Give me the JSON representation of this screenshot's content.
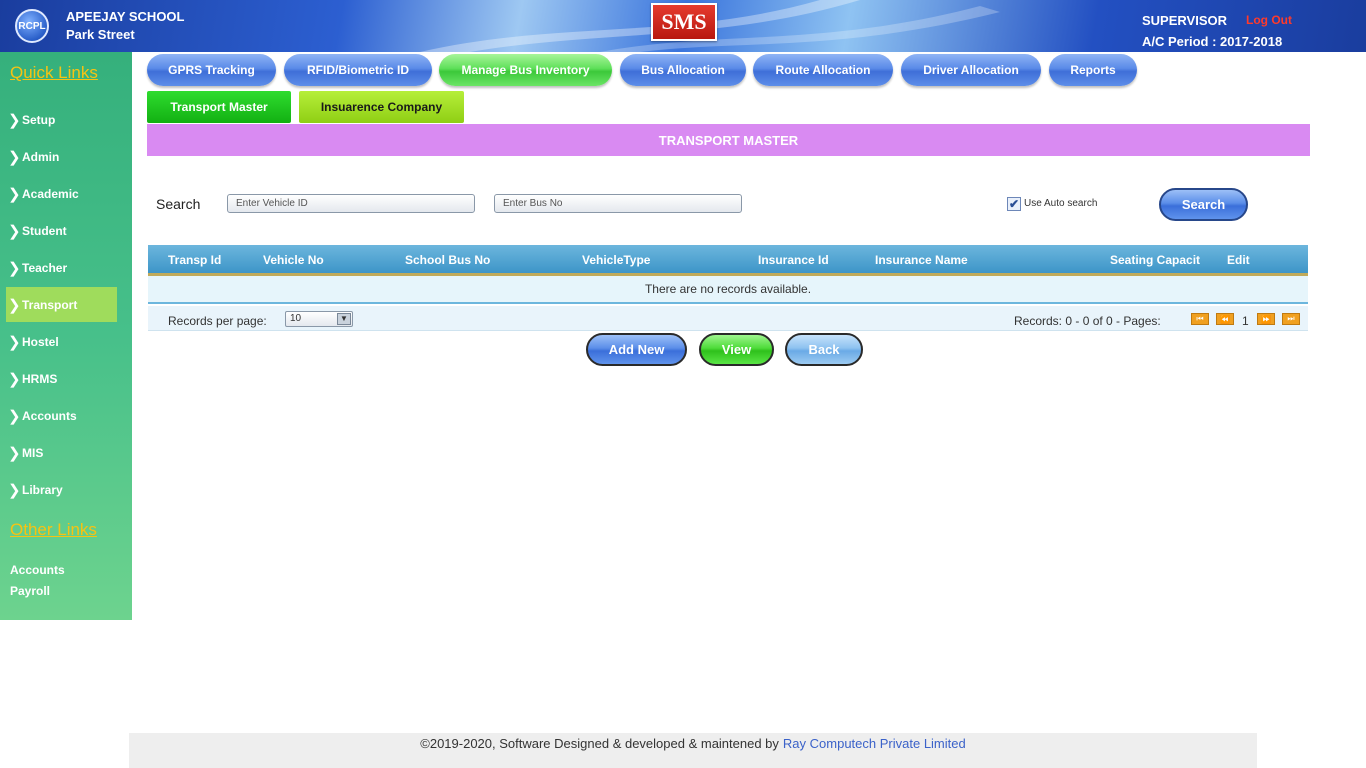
{
  "header": {
    "school_name_line1": "APEEJAY SCHOOL",
    "school_name_line2": "Park Street",
    "logo_text": "RCPL",
    "app_logo": "SMS",
    "user_role": "SUPERVISOR",
    "logout_label": "Log Out",
    "ac_period": "A/C Period : 2017-2018"
  },
  "sidebar": {
    "quick_links_heading": "Quick Links",
    "items": [
      {
        "label": "Setup"
      },
      {
        "label": "Admin"
      },
      {
        "label": "Academic"
      },
      {
        "label": "Student"
      },
      {
        "label": "Teacher"
      },
      {
        "label": "Transport",
        "active": true
      },
      {
        "label": "Hostel"
      },
      {
        "label": "HRMS"
      },
      {
        "label": "Accounts"
      },
      {
        "label": "MIS"
      },
      {
        "label": "Library"
      }
    ],
    "other_links_heading": "Other Links",
    "other_links": [
      {
        "label": "Accounts"
      },
      {
        "label": "Payroll"
      }
    ]
  },
  "top_nav": {
    "tabs": [
      {
        "label": "GPRS Tracking"
      },
      {
        "label": "RFID/Biometric ID"
      },
      {
        "label": "Manage Bus Inventory",
        "active": true
      },
      {
        "label": "Bus Allocation"
      },
      {
        "label": "Route Allocation"
      },
      {
        "label": "Driver Allocation"
      },
      {
        "label": "Reports"
      }
    ],
    "sub_tabs": [
      {
        "label": "Transport Master",
        "active": true
      },
      {
        "label": "Insuarence Company"
      }
    ]
  },
  "page": {
    "banner_title": "TRANSPORT MASTER",
    "search_label": "Search",
    "vehicle_id_placeholder": "Enter Vehicle ID",
    "bus_no_placeholder": "Enter Bus No",
    "auto_search_label": "Use Auto search",
    "auto_search_checked": true,
    "search_button": "Search"
  },
  "grid": {
    "columns": [
      "Transp Id",
      "Vehicle No",
      "School Bus No",
      "VehicleType",
      "Insurance Id",
      "Insurance Name",
      "Seating Capacit",
      "Edit"
    ],
    "empty_message": "There are no records available.",
    "records_per_page_label": "Records per page:",
    "records_per_page_value": "10",
    "records_info": "Records: 0 - 0 of 0 - Pages:",
    "current_page": "1"
  },
  "actions": {
    "add_new": "Add New",
    "view": "View",
    "back": "Back"
  },
  "footer": {
    "text": "©2019-2020, Software Designed & developed & maintened by",
    "company": "Ray Computech Private Limited"
  },
  "colors": {
    "banner": "#d98af2",
    "sidebar_active": "#9fdc5c",
    "logout": "#ff3a2a",
    "link": "#3b62c9"
  }
}
